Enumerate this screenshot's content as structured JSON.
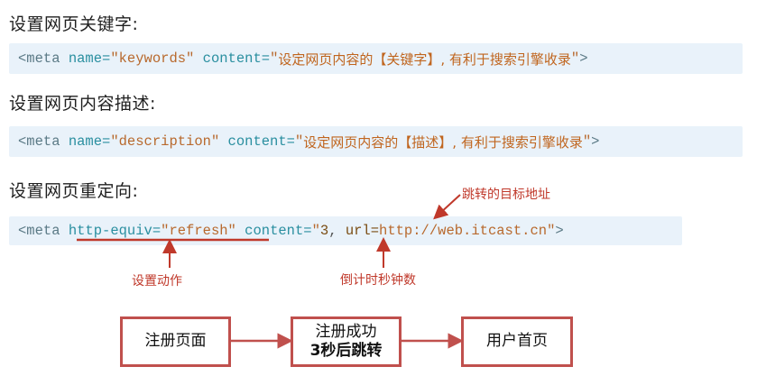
{
  "sections": [
    {
      "heading": "设置网页关键字:",
      "code": {
        "open": "<meta ",
        "attr1": "name=",
        "val1": "\"keywords\"",
        "attr2": " content=",
        "q1": "\"",
        "text": "设定网页内容的【关键字】, 有利于搜索引擎收录",
        "q2": "\"",
        "close": ">"
      }
    },
    {
      "heading": "设置网页内容描述:",
      "code": {
        "open": "<meta ",
        "attr1": "name=",
        "val1": "\"description\"",
        "attr2": " content=",
        "q1": "\"",
        "text": "设定网页内容的【描述】, 有利于搜索引擎收录",
        "q2": "\"",
        "close": ">"
      }
    },
    {
      "heading": "设置网页重定向:",
      "code": {
        "open": "<meta ",
        "attr1": "http-equiv=",
        "val1": "\"refresh\"",
        "attr2": " content=",
        "q1": "\"",
        "num": "3",
        "sep": ", ",
        "attr3": "url=",
        "url": "http://web.itcast.cn",
        "q2": "\"",
        "close": ">"
      }
    }
  ],
  "annotations": {
    "target": "跳转的目标地址",
    "action": "设置动作",
    "countdown": "倒计时秒钟数"
  },
  "flow": {
    "step1": "注册页面",
    "step2_line1": "注册成功",
    "step2_line2": "3秒后跳转",
    "step3": "用户首页"
  },
  "colors": {
    "code_bg": "#e9f2fa",
    "annotation": "#c0392b",
    "flow_border": "#c0504d"
  }
}
